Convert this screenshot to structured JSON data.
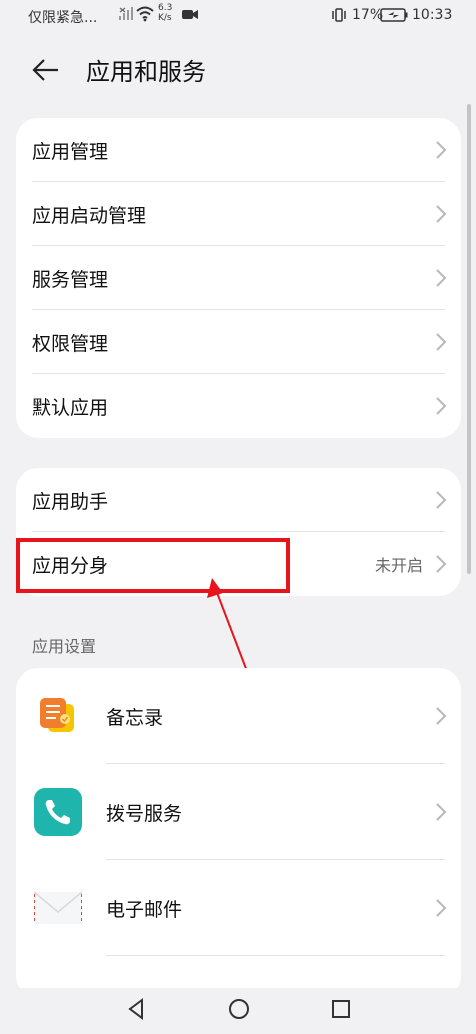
{
  "status": {
    "carrier": "仅限紧急...",
    "speed_top": "6.3",
    "speed_bottom": "K/s",
    "battery": "17%",
    "time": "10:33"
  },
  "header": {
    "title": "应用和服务"
  },
  "group1": {
    "items": [
      {
        "label": "应用管理"
      },
      {
        "label": "应用启动管理"
      },
      {
        "label": "服务管理"
      },
      {
        "label": "权限管理"
      },
      {
        "label": "默认应用"
      }
    ]
  },
  "group2": {
    "items": [
      {
        "label": "应用助手"
      },
      {
        "label": "应用分身",
        "value": "未开启"
      }
    ]
  },
  "app_settings": {
    "section_label": "应用设置",
    "items": [
      {
        "label": "备忘录",
        "icon": "notes-icon"
      },
      {
        "label": "拨号服务",
        "icon": "phone-icon"
      },
      {
        "label": "电子邮件",
        "icon": "email-icon"
      }
    ]
  },
  "colors": {
    "highlight": "#e8141b",
    "phone_icon": "#1fb5ad",
    "notes_icon": "#f5a623"
  }
}
